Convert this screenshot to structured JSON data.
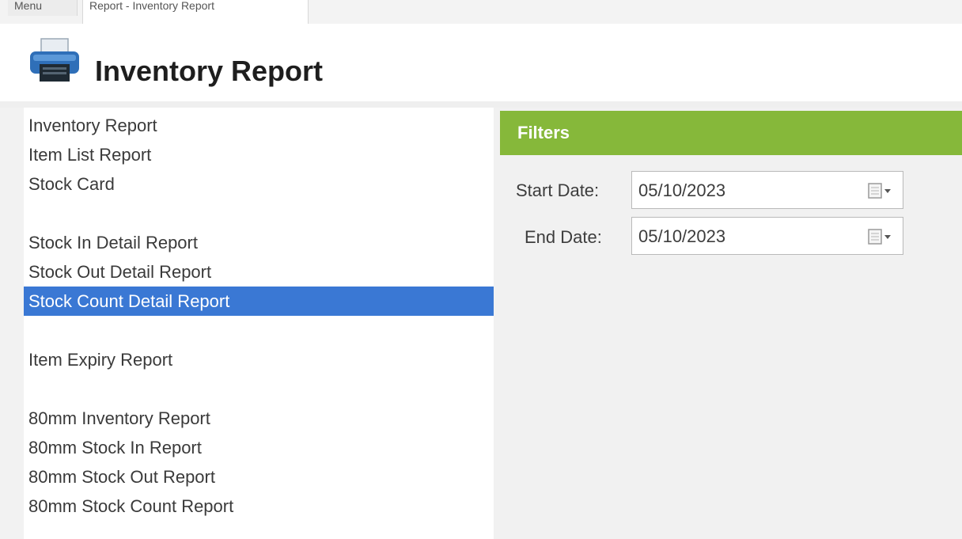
{
  "tabs": {
    "menu_label": "Menu",
    "active_label": "Report - Inventory Report"
  },
  "header": {
    "title": "Inventory Report",
    "icon": "printer-icon"
  },
  "reports": [
    {
      "label": "Inventory Report"
    },
    {
      "label": "Item List Report"
    },
    {
      "label": "Stock Card"
    },
    {
      "label": "Stock In Detail Report"
    },
    {
      "label": "Stock Out Detail Report"
    },
    {
      "label": "Stock Count Detail Report",
      "selected": true
    },
    {
      "label": "Item Expiry Report"
    },
    {
      "label": "80mm Inventory Report"
    },
    {
      "label": "80mm Stock In Report"
    },
    {
      "label": "80mm Stock Out Report"
    },
    {
      "label": "80mm Stock Count Report"
    }
  ],
  "filters": {
    "title": "Filters",
    "start_label": "Start Date:",
    "start_value": "05/10/2023",
    "end_label": "End Date:",
    "end_value": "05/10/2023"
  },
  "colors": {
    "selected": "#3a78d4",
    "filters_bar": "#86b83a"
  }
}
